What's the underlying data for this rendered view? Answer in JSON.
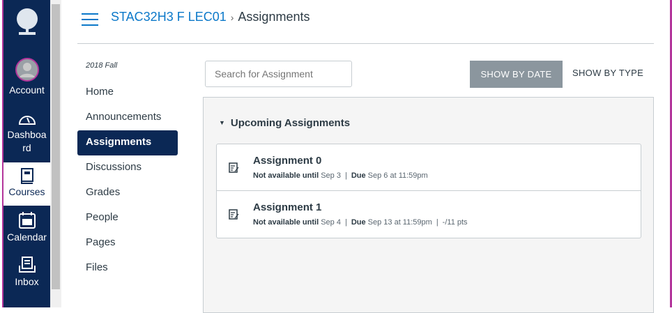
{
  "global_nav": {
    "items": [
      {
        "label": "Account"
      },
      {
        "label": "Dashboard",
        "display": "Dashboa rd"
      },
      {
        "label": "Courses"
      },
      {
        "label": "Calendar"
      },
      {
        "label": "Inbox"
      }
    ]
  },
  "header": {
    "course": "STAC32H3 F LEC01",
    "page": "Assignments",
    "separator": "›"
  },
  "course_nav": {
    "term": "2018 Fall",
    "items": [
      "Home",
      "Announcements",
      "Assignments",
      "Discussions",
      "Grades",
      "People",
      "Pages",
      "Files"
    ],
    "active": "Assignments"
  },
  "toolbar": {
    "search_placeholder": "Search for Assignment",
    "show_by_date": "SHOW BY DATE",
    "show_by_type": "SHOW BY TYPE"
  },
  "group": {
    "title": "Upcoming Assignments",
    "assignments": [
      {
        "title": "Assignment 0",
        "avail_label": "Not available until",
        "avail": "Sep 3",
        "due_label": "Due",
        "due": "Sep 6 at 11:59pm",
        "points": ""
      },
      {
        "title": "Assignment 1",
        "avail_label": "Not available until",
        "avail": "Sep 4",
        "due_label": "Due",
        "due": "Sep 13 at 11:59pm",
        "points": "-/11 pts"
      }
    ]
  },
  "colors": {
    "nav": "#0b2855",
    "accent": "#0b78c9",
    "border_accent": "#b3359b"
  }
}
